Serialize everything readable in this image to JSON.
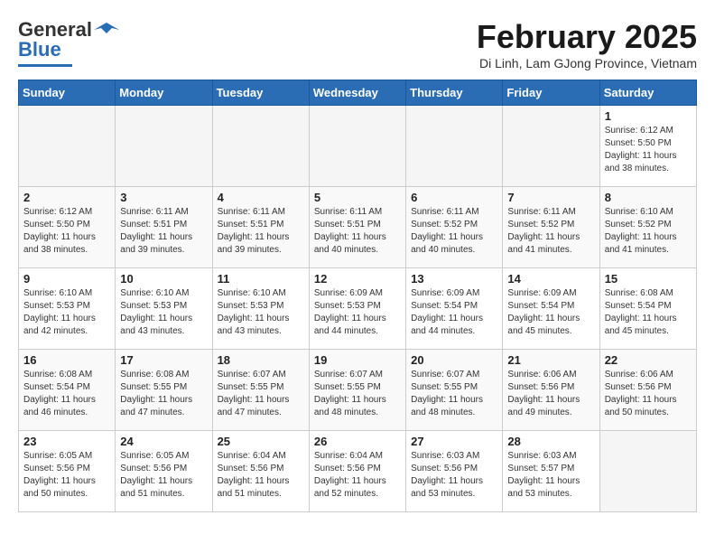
{
  "header": {
    "logo_general": "General",
    "logo_blue": "Blue",
    "month": "February 2025",
    "location": "Di Linh, Lam GJong Province, Vietnam"
  },
  "weekdays": [
    "Sunday",
    "Monday",
    "Tuesday",
    "Wednesday",
    "Thursday",
    "Friday",
    "Saturday"
  ],
  "weeks": [
    [
      {
        "day": "",
        "info": ""
      },
      {
        "day": "",
        "info": ""
      },
      {
        "day": "",
        "info": ""
      },
      {
        "day": "",
        "info": ""
      },
      {
        "day": "",
        "info": ""
      },
      {
        "day": "",
        "info": ""
      },
      {
        "day": "1",
        "info": "Sunrise: 6:12 AM\nSunset: 5:50 PM\nDaylight: 11 hours\nand 38 minutes."
      }
    ],
    [
      {
        "day": "2",
        "info": "Sunrise: 6:12 AM\nSunset: 5:50 PM\nDaylight: 11 hours\nand 38 minutes."
      },
      {
        "day": "3",
        "info": "Sunrise: 6:11 AM\nSunset: 5:51 PM\nDaylight: 11 hours\nand 39 minutes."
      },
      {
        "day": "4",
        "info": "Sunrise: 6:11 AM\nSunset: 5:51 PM\nDaylight: 11 hours\nand 39 minutes."
      },
      {
        "day": "5",
        "info": "Sunrise: 6:11 AM\nSunset: 5:51 PM\nDaylight: 11 hours\nand 40 minutes."
      },
      {
        "day": "6",
        "info": "Sunrise: 6:11 AM\nSunset: 5:52 PM\nDaylight: 11 hours\nand 40 minutes."
      },
      {
        "day": "7",
        "info": "Sunrise: 6:11 AM\nSunset: 5:52 PM\nDaylight: 11 hours\nand 41 minutes."
      },
      {
        "day": "8",
        "info": "Sunrise: 6:10 AM\nSunset: 5:52 PM\nDaylight: 11 hours\nand 41 minutes."
      }
    ],
    [
      {
        "day": "9",
        "info": "Sunrise: 6:10 AM\nSunset: 5:53 PM\nDaylight: 11 hours\nand 42 minutes."
      },
      {
        "day": "10",
        "info": "Sunrise: 6:10 AM\nSunset: 5:53 PM\nDaylight: 11 hours\nand 43 minutes."
      },
      {
        "day": "11",
        "info": "Sunrise: 6:10 AM\nSunset: 5:53 PM\nDaylight: 11 hours\nand 43 minutes."
      },
      {
        "day": "12",
        "info": "Sunrise: 6:09 AM\nSunset: 5:53 PM\nDaylight: 11 hours\nand 44 minutes."
      },
      {
        "day": "13",
        "info": "Sunrise: 6:09 AM\nSunset: 5:54 PM\nDaylight: 11 hours\nand 44 minutes."
      },
      {
        "day": "14",
        "info": "Sunrise: 6:09 AM\nSunset: 5:54 PM\nDaylight: 11 hours\nand 45 minutes."
      },
      {
        "day": "15",
        "info": "Sunrise: 6:08 AM\nSunset: 5:54 PM\nDaylight: 11 hours\nand 45 minutes."
      }
    ],
    [
      {
        "day": "16",
        "info": "Sunrise: 6:08 AM\nSunset: 5:54 PM\nDaylight: 11 hours\nand 46 minutes."
      },
      {
        "day": "17",
        "info": "Sunrise: 6:08 AM\nSunset: 5:55 PM\nDaylight: 11 hours\nand 47 minutes."
      },
      {
        "day": "18",
        "info": "Sunrise: 6:07 AM\nSunset: 5:55 PM\nDaylight: 11 hours\nand 47 minutes."
      },
      {
        "day": "19",
        "info": "Sunrise: 6:07 AM\nSunset: 5:55 PM\nDaylight: 11 hours\nand 48 minutes."
      },
      {
        "day": "20",
        "info": "Sunrise: 6:07 AM\nSunset: 5:55 PM\nDaylight: 11 hours\nand 48 minutes."
      },
      {
        "day": "21",
        "info": "Sunrise: 6:06 AM\nSunset: 5:56 PM\nDaylight: 11 hours\nand 49 minutes."
      },
      {
        "day": "22",
        "info": "Sunrise: 6:06 AM\nSunset: 5:56 PM\nDaylight: 11 hours\nand 50 minutes."
      }
    ],
    [
      {
        "day": "23",
        "info": "Sunrise: 6:05 AM\nSunset: 5:56 PM\nDaylight: 11 hours\nand 50 minutes."
      },
      {
        "day": "24",
        "info": "Sunrise: 6:05 AM\nSunset: 5:56 PM\nDaylight: 11 hours\nand 51 minutes."
      },
      {
        "day": "25",
        "info": "Sunrise: 6:04 AM\nSunset: 5:56 PM\nDaylight: 11 hours\nand 51 minutes."
      },
      {
        "day": "26",
        "info": "Sunrise: 6:04 AM\nSunset: 5:56 PM\nDaylight: 11 hours\nand 52 minutes."
      },
      {
        "day": "27",
        "info": "Sunrise: 6:03 AM\nSunset: 5:56 PM\nDaylight: 11 hours\nand 53 minutes."
      },
      {
        "day": "28",
        "info": "Sunrise: 6:03 AM\nSunset: 5:57 PM\nDaylight: 11 hours\nand 53 minutes."
      },
      {
        "day": "",
        "info": ""
      }
    ]
  ]
}
